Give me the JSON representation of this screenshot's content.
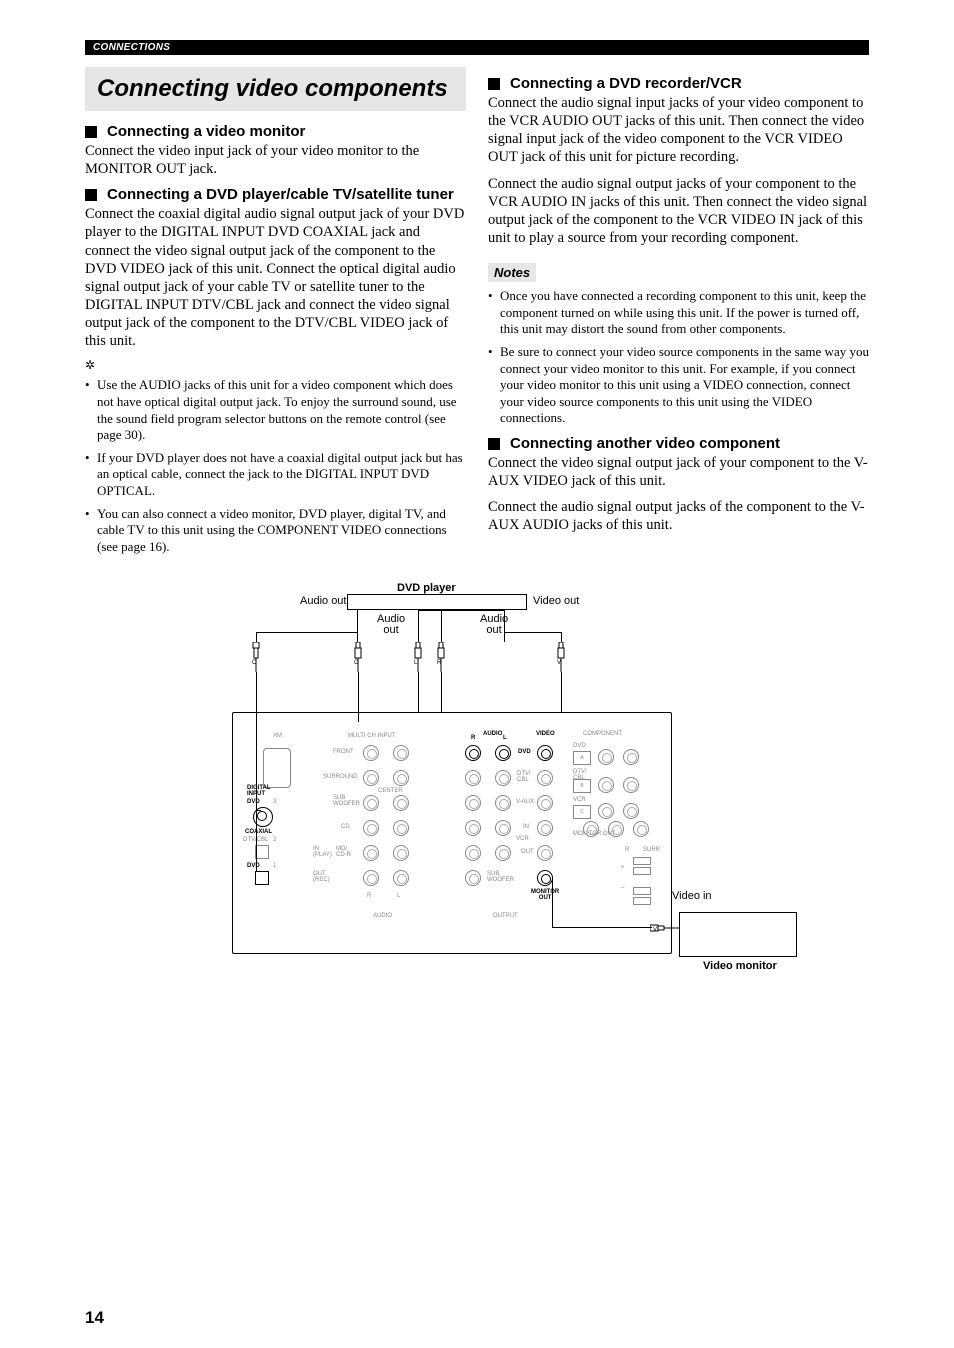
{
  "section_bar": "CONNECTIONS",
  "main_title": "Connecting video components",
  "page_number": "14",
  "left": {
    "h1": "Connecting a video monitor",
    "p1": "Connect the video input jack of your video monitor to the MONITOR OUT jack.",
    "h2": "Connecting a DVD player/cable TV/satellite tuner",
    "p2": "Connect the coaxial digital audio signal output jack of your DVD player to the DIGITAL INPUT DVD COAXIAL jack and connect the video signal output jack of the component to the DVD VIDEO jack of this unit. Connect the optical digital audio signal output jack of your cable TV or satellite tuner to the DIGITAL INPUT DTV/CBL jack and connect the video signal output jack of the component to the DTV/CBL VIDEO jack of this unit.",
    "tips": [
      "Use the AUDIO jacks of this unit for a video component which does not have optical digital output jack. To enjoy the surround sound, use the sound field program selector buttons on the remote control (see page 30).",
      "If your DVD player does not have a coaxial digital output jack but has an optical cable, connect the jack to the DIGITAL INPUT DVD OPTICAL.",
      "You can also connect a video monitor, DVD player, digital TV, and cable TV to this unit using the COMPONENT VIDEO connections (see page 16)."
    ]
  },
  "right": {
    "h1": "Connecting a DVD recorder/VCR",
    "p1": "Connect the audio signal input jacks of your video component to the VCR AUDIO OUT jacks of this unit. Then connect the video signal input jack of the video component to the VCR VIDEO OUT jack of this unit for picture recording.",
    "p2": "Connect the audio signal output jacks of your component to the VCR AUDIO IN jacks of this unit. Then connect the video signal output jack of the component to the VCR VIDEO IN jack of this unit to play a source from your recording component.",
    "notes_label": "Notes",
    "notes": [
      "Once you have connected a recording component to this unit, keep the component turned on while using this unit. If the power is turned off, this unit may distort the sound from other components.",
      "Be sure to connect your video source components in the same way you connect your video monitor to this unit. For example, if you connect your video monitor to this unit using a VIDEO connection, connect your video source components to this unit using the VIDEO connections."
    ],
    "h2": "Connecting another video component",
    "p3": "Connect the video signal output jack of your component to the V-AUX VIDEO jack of this unit.",
    "p4": "Connect the audio signal output jacks of the component to the V-AUX AUDIO jacks of this unit."
  },
  "diagram": {
    "dvd_title": "DVD player",
    "audio_out_left": "Audio out",
    "video_out_right": "Video out",
    "audio_out_1": "Audio\nout",
    "audio_out_2": "Audio\nout",
    "video_in": "Video in",
    "monitor": "Video monitor",
    "plug_labels": {
      "O": "O",
      "C": "C",
      "L": "L",
      "R": "R",
      "V": "V"
    },
    "panel": {
      "xm": "XM",
      "multi": "MULTI CH INPUT",
      "audio_h": "AUDIO",
      "video_h": "VIDEO",
      "component": "COMPONENT",
      "front": "FRONT",
      "surround": "SURROUND",
      "subwoofer": "SUB\nWOOFER",
      "center": "CENTER",
      "dvd": "DVD",
      "dtvcbl": "DTV/\nCBL",
      "vaux": "V-AUX",
      "in": "IN",
      "vcr": "VCR",
      "out": "OUT",
      "cd": "CD",
      "mdcdr": "MD/\nCD-R",
      "in_play": "IN\n(PLAY)",
      "out_rec": "OUT\n(REC)",
      "subwoofer_out": "SUB\nWOOFER",
      "monitor_out": "MONITOR\nOUT",
      "digital_input": "DIGITAL\nINPUT",
      "coaxial": "COAXIAL",
      "dtvcbl_num": "DTV/CBL",
      "dvd_opt": "DVD",
      "dvd_comp": "DVD",
      "dtvcbl_comp": "DTV/\nCBL",
      "vcr_comp": "VCR",
      "monitor_out_comp": "MONITOR OUT",
      "r": "R",
      "l": "L",
      "audio_foot": "AUDIO",
      "output": "OUTPUT",
      "surr": "SURR",
      "num1": "1",
      "num2": "2",
      "num3": "3",
      "a": "A",
      "b": "B",
      "c": "C"
    }
  }
}
